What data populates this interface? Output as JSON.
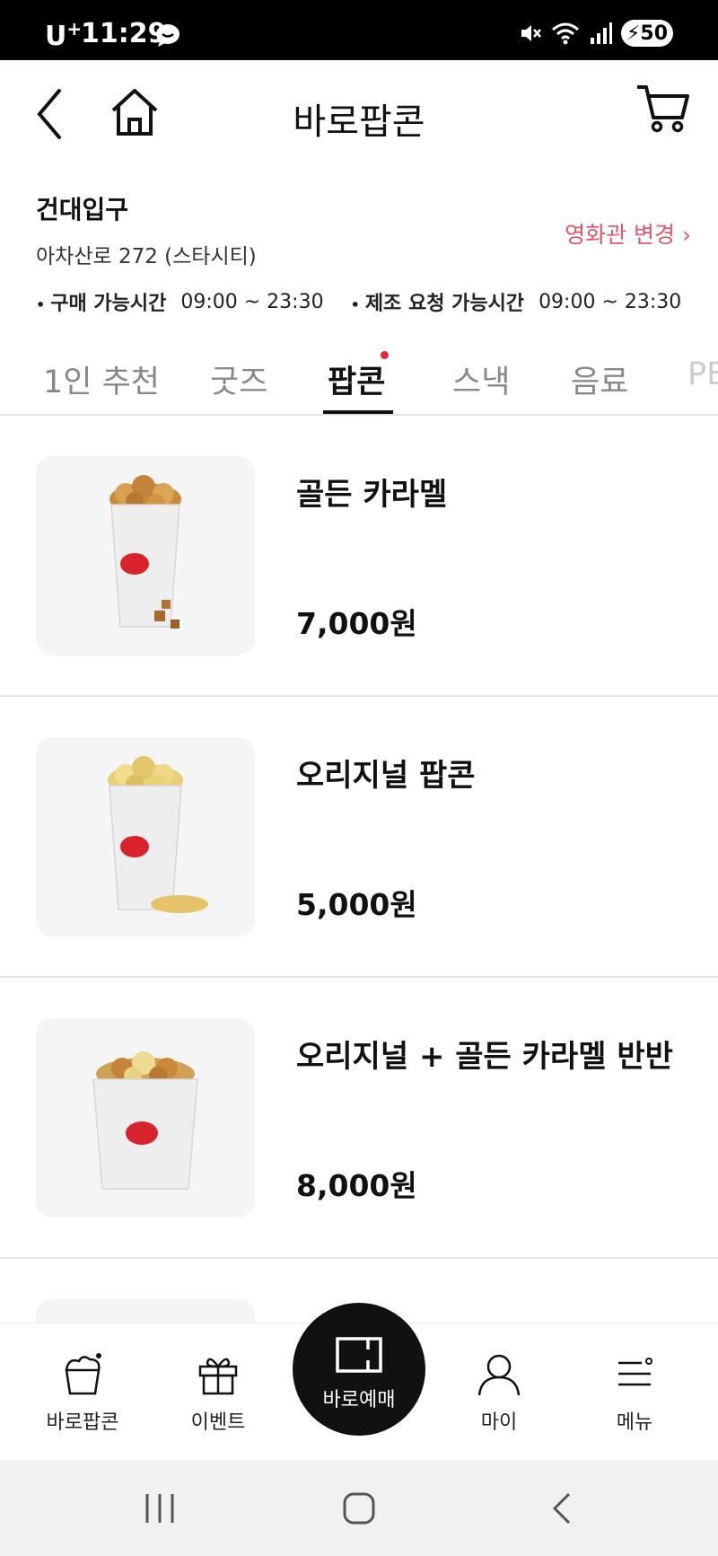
{
  "status_bar": {
    "carrier": "U",
    "carrier_sup": "+",
    "time": "11:29",
    "battery": "50"
  },
  "header": {
    "title": "바로팝콘"
  },
  "theater": {
    "name": "건대입구",
    "address": "아차산로 272 (스타시티)",
    "change_label": "영화관 변경 ›",
    "purchase_hours_label": "구매 가능시간",
    "purchase_hours": "09:00 ~ 23:30",
    "request_hours_label": "제조 요청 가능시간",
    "request_hours": "09:00 ~ 23:30"
  },
  "tabs": [
    {
      "label": "1인 추천",
      "active": false
    },
    {
      "label": "굿즈",
      "active": false
    },
    {
      "label": "팝콘",
      "active": true
    },
    {
      "label": "스낵",
      "active": false
    },
    {
      "label": "음료",
      "active": false
    },
    {
      "label": "PE",
      "active": false
    }
  ],
  "products": [
    {
      "name": "골든 카라멜",
      "price": "7,000원"
    },
    {
      "name": "오리지널 팝콘",
      "price": "5,000원"
    },
    {
      "name": "오리지널 + 골든 카라멜 반반",
      "price": "8,000원"
    }
  ],
  "bottom_nav": {
    "items": [
      {
        "label": "바로팝콘",
        "icon": "popcorn-icon"
      },
      {
        "label": "이벤트",
        "icon": "gift-icon"
      },
      {
        "label": "바로예매",
        "icon": "ticket-icon"
      },
      {
        "label": "마이",
        "icon": "person-icon"
      },
      {
        "label": "메뉴",
        "icon": "menu-icon"
      }
    ]
  },
  "colors": {
    "accent": "#e0576a",
    "tab_dot": "#e8253b",
    "cup_logo": "#d9232d"
  }
}
